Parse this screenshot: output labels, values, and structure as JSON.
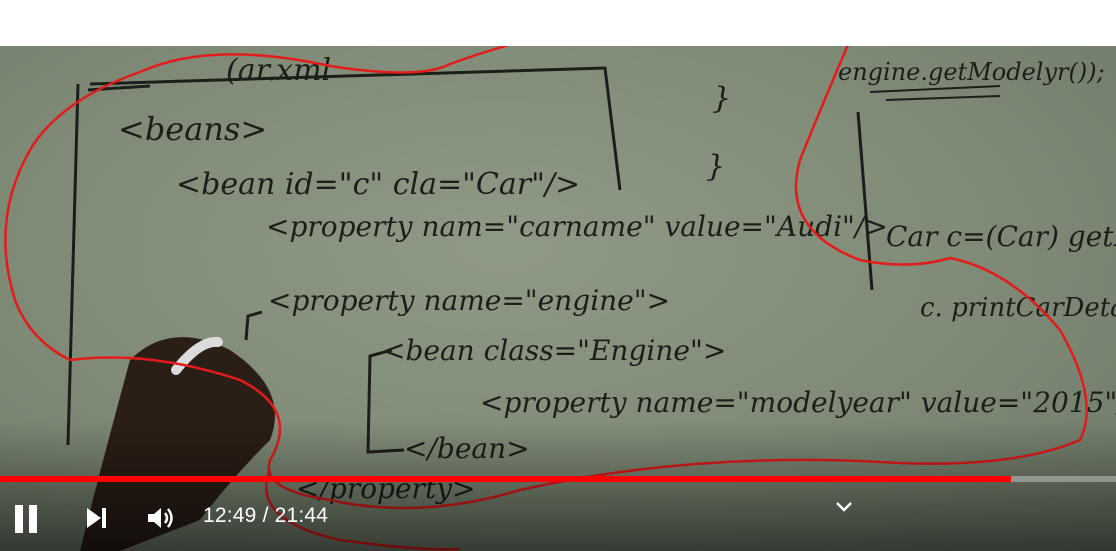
{
  "player": {
    "current_time": "12:49",
    "separator": "/",
    "duration": "21:44",
    "progress_percent": 90.6,
    "colors": {
      "played": "#ff0000",
      "controls": "#ffffff"
    },
    "icons": {
      "pause": "pause-icon",
      "next": "next-icon",
      "volume": "volume-icon",
      "chevron": "chevron-down-icon"
    }
  }
}
